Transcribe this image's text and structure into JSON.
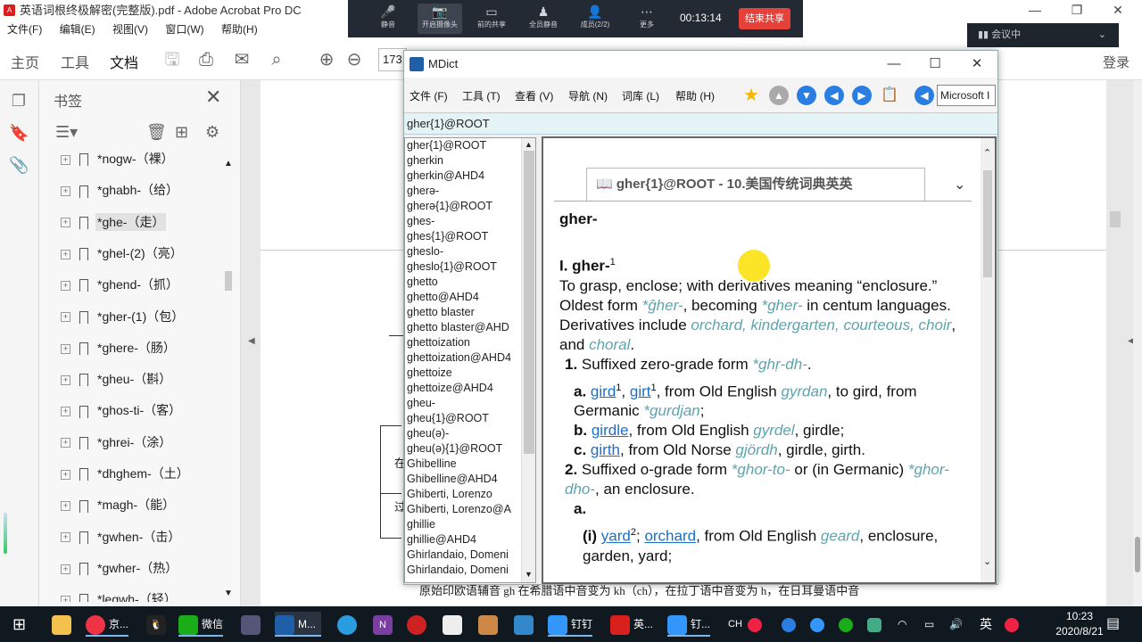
{
  "acrobat": {
    "title": "英语词根终极解密(完整版).pdf - Adobe Acrobat Pro DC",
    "menu": [
      "文件(F)",
      "编辑(E)",
      "视图(V)",
      "窗口(W)",
      "帮助(H)"
    ],
    "tabs": {
      "home": "主页",
      "tools": "工具",
      "document": "文档"
    },
    "page_number": "173",
    "login": "登录"
  },
  "meeting": {
    "buttons": [
      "静音",
      "开启摄像头",
      "前的共享",
      "全员静音",
      "成员(2/2)",
      "更多"
    ],
    "time": "00:13:14",
    "end_label": "结束共享",
    "status": "会议中"
  },
  "bookmarks": {
    "title": "书签",
    "items": [
      "*nogw-（裸）",
      "*ghabh-（给）",
      "*ghe-（走）",
      "*ghel-(2)（亮）",
      "*ghend-（抓）",
      "*gher-(1)（包）",
      "*ghere-（肠）",
      "*gheu-（斟）",
      "*ghos-ti-（客）",
      "*ghrei-（涂）",
      "*dhghem-（土）",
      "*magh-（能）",
      "*gwhen-（击）",
      "*gwher-（热）",
      "*legwh-（轻）"
    ],
    "selected_index": 2
  },
  "doc": {
    "bottom_text": "原始印欧语辅音 gh 在希腊语中音变为 kh（ch），在拉丁语中音变为 h，在日耳曼语中音",
    "side1": "在",
    "side2": "过"
  },
  "mdict": {
    "title": "MDict",
    "menu": [
      "文件 (F)",
      "工具 (T)",
      "查看 (V)",
      "导航 (N)",
      "词库 (L)",
      "帮助 (H)"
    ],
    "dict_select": "Microsoft I",
    "search_value": "gher{1}@ROOT",
    "words": [
      "gher{1}@ROOT",
      "gherkin",
      "gherkin@AHD4",
      "gherə-",
      "gherə{1}@ROOT",
      "ghes-",
      "ghes{1}@ROOT",
      "gheslo-",
      "gheslo{1}@ROOT",
      "ghetto",
      "ghetto@AHD4",
      "ghetto blaster",
      "ghetto blaster@AHD",
      "ghettoization",
      "ghettoization@AHD4",
      "ghettoize",
      "ghettoize@AHD4",
      "gheu-",
      "gheu{1}@ROOT",
      "gheu(ə)-",
      "gheu(ə){1}@ROOT",
      "Ghibelline",
      "Ghibelline@AHD4",
      "Ghiberti, Lorenzo",
      "Ghiberti, Lorenzo@A",
      "ghillie",
      "ghillie@AHD4",
      "Ghirlandaio, Domeni",
      "Ghirlandaio, Domeni"
    ],
    "entry": {
      "header": "gher{1}@ROOT - 10.美国传统词典英英",
      "headword": "gher-",
      "sense": "I. gher-",
      "sup1": "1",
      "def1": " To grasp, enclose; with derivatives meaning “enclosure.” Oldest form ",
      "f1": "*ĝher-",
      "def1b": ", becoming ",
      "f2": "*gher-",
      "def1c": " in centum languages.",
      "deriv": " Derivatives include ",
      "d1": "orchard, kindergarten, courteous, choir",
      "deriv_and": ", and ",
      "d2": "choral",
      "dot": ".",
      "n1": "1.",
      "n1t": " Suffixed zero-grade form ",
      "n1f": "*ghṛ-dh-",
      "a": "a.",
      "gird": "gird",
      "girt": "girt",
      "a_t": ", from Old English ",
      "gyrdan": "gyrdan",
      "a_t2": ", to gird, from Germanic ",
      "gurdjan": "*gurdjan",
      "semi": ";",
      "b": "b.",
      "girdle": "girdle",
      "b_t": ", from Old English ",
      "gyrdel": "gyrdel",
      "b_t2": ", girdle;",
      "c": "c.",
      "girth": "girth",
      "c_t": ", from Old Norse ",
      "gjordh": "gjördh",
      "c_t2": ", girdle, girth.",
      "n2": "2.",
      "n2t": " Suffixed o-grade form ",
      "n2f": "*ghor-to-",
      "n2t2": " or (in Germanic) ",
      "n2f2": "*ghor-dho-",
      "n2t3": ", an enclosure.",
      "a2": "a.",
      "i": "(i)",
      "yard": "yard",
      "sup2": "2",
      "semi2": "; ",
      "orchard": "orchard",
      "i_t": ", from Old English ",
      "geard": "geard",
      "i_t2": ", enclosure, garden, yard;"
    }
  },
  "taskbar": {
    "items": [
      "京...",
      "微信",
      "M...",
      "钉钉",
      "英...",
      "钉..."
    ],
    "ime": "英",
    "clock_time": "10:23",
    "clock_date": "2020/8/21"
  }
}
